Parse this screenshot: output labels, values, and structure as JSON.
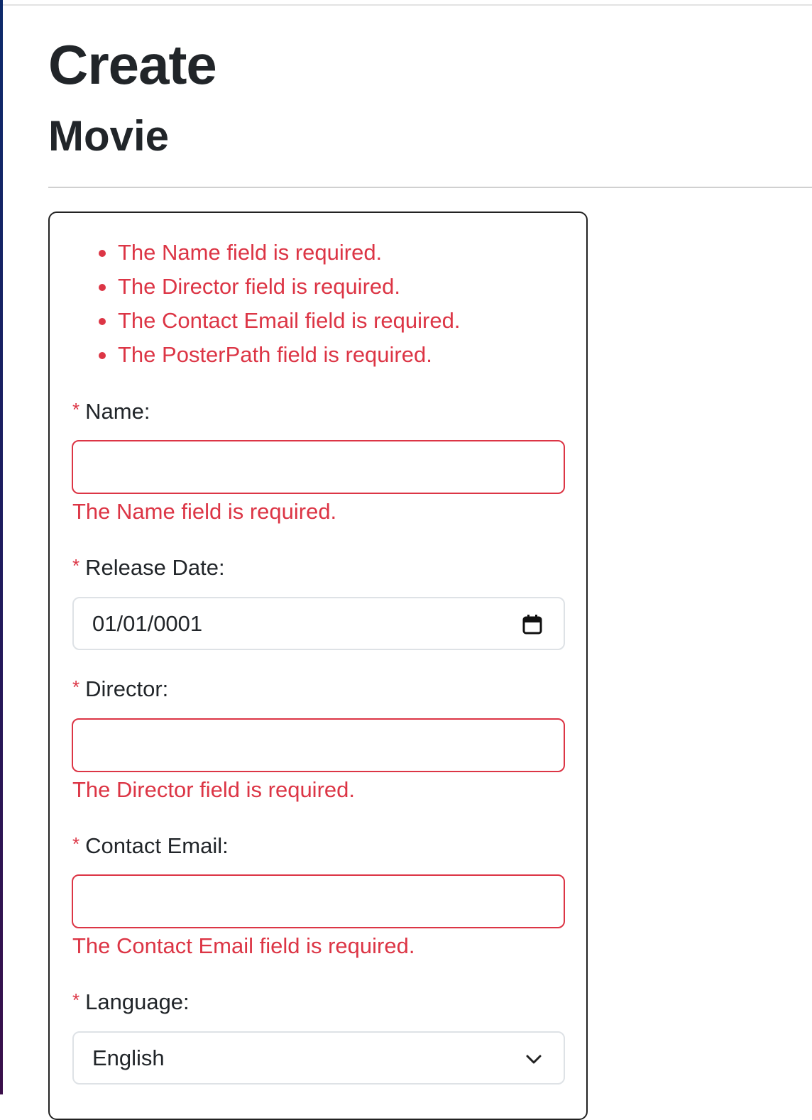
{
  "header": {
    "title": "Create",
    "subtitle": "Movie"
  },
  "validation_summary": [
    "The Name field is required.",
    "The Director field is required.",
    "The Contact Email field is required.",
    "The PosterPath field is required."
  ],
  "form": {
    "required_marker": "*",
    "name": {
      "label": "Name:",
      "value": "",
      "error": "The Name field is required."
    },
    "release_date": {
      "label": "Release Date:",
      "value": "01/01/0001",
      "icon": "calendar-icon"
    },
    "director": {
      "label": "Director:",
      "value": "",
      "error": "The Director field is required."
    },
    "contact_email": {
      "label": "Contact Email:",
      "value": "",
      "error": "The Contact Email field is required."
    },
    "language": {
      "label": "Language:",
      "selected": "English",
      "icon": "chevron-down-icon"
    }
  },
  "colors": {
    "error": "#dc3545",
    "text": "#212529",
    "border": "#dee2e6"
  }
}
